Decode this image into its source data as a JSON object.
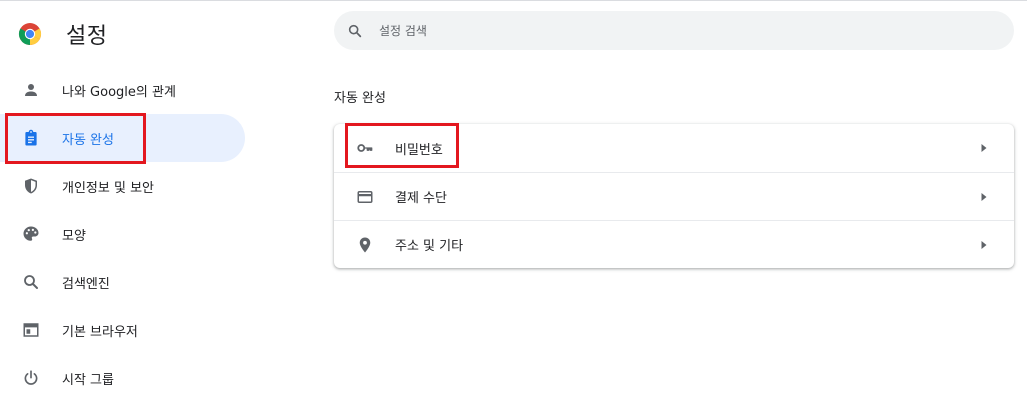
{
  "header": {
    "title": "설정",
    "logo_icon": "chrome-logo-icon"
  },
  "search": {
    "placeholder": "설정 검색",
    "icon": "search-icon"
  },
  "sidebar": {
    "items": [
      {
        "label": "나와 Google의 관계",
        "icon": "person-icon",
        "active": false
      },
      {
        "label": "자동 완성",
        "icon": "clipboard-icon",
        "active": true
      },
      {
        "label": "개인정보 및 보안",
        "icon": "shield-icon",
        "active": false
      },
      {
        "label": "모양",
        "icon": "palette-icon",
        "active": false
      },
      {
        "label": "검색엔진",
        "icon": "search-icon",
        "active": false
      },
      {
        "label": "기본 브라우저",
        "icon": "browser-window-icon",
        "active": false
      },
      {
        "label": "시작 그룹",
        "icon": "power-icon",
        "active": false
      }
    ]
  },
  "main": {
    "section_title": "자동 완성",
    "rows": [
      {
        "label": "비밀번호",
        "icon": "key-icon"
      },
      {
        "label": "결제 수단",
        "icon": "credit-card-icon"
      },
      {
        "label": "주소 및 기타",
        "icon": "location-pin-icon"
      }
    ]
  },
  "colors": {
    "accent": "#1a73e8",
    "active_bg": "#e8f0fe",
    "highlight_annotation": "#e3171f",
    "icon_gray": "#5f6368"
  }
}
